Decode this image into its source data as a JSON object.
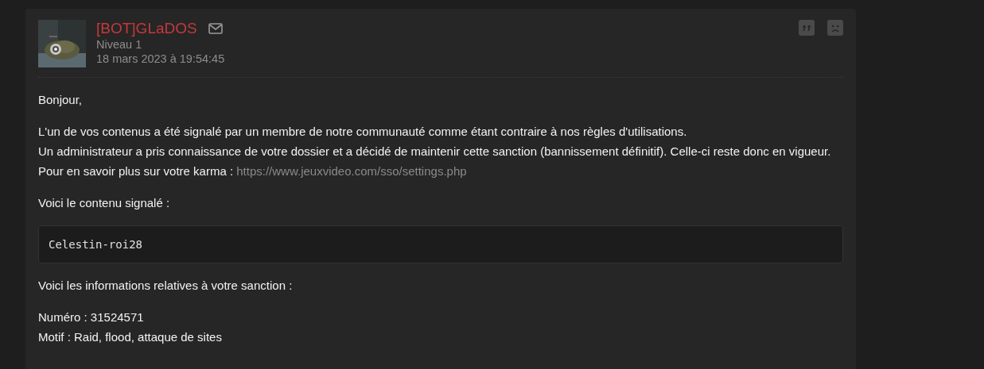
{
  "message": {
    "author": {
      "name": "[BOT]GLaDOS",
      "level": "Niveau 1",
      "date": "18 mars 2023 à 19:54:45"
    },
    "blocks": [
      {
        "kind": "text",
        "lines": [
          {
            "text": "Bonjour,"
          }
        ]
      },
      {
        "kind": "text",
        "lines": [
          {
            "text": "L'un de vos contenus a été signalé par un membre de notre communauté comme étant contraire à nos règles d'utilisations."
          },
          {
            "text": "Un administrateur a pris connaissance de votre dossier et a décidé de maintenir cette sanction (bannissement définitif). Celle-ci reste donc en vigueur."
          },
          {
            "text": "Pour en savoir plus sur votre karma : ",
            "link": "https://www.jeuxvideo.com/sso/settings.php"
          }
        ]
      },
      {
        "kind": "text",
        "lines": [
          {
            "text": "Voici le contenu signalé :"
          }
        ]
      },
      {
        "kind": "code",
        "lines": [
          {
            "text": "Celestin-roi28"
          }
        ]
      },
      {
        "kind": "text",
        "lines": [
          {
            "text": "Voici les informations relatives à votre sanction :"
          }
        ]
      },
      {
        "kind": "text",
        "lines": [
          {
            "text": "Numéro : 31524571"
          },
          {
            "text": "Motif : Raid, flood, attaque de sites"
          }
        ]
      }
    ]
  }
}
